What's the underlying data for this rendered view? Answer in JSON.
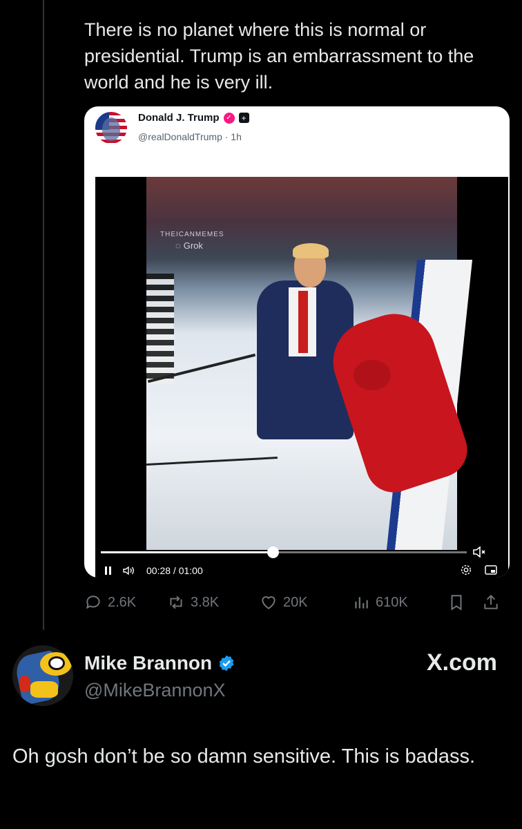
{
  "parent_tweet": {
    "text": "There is no planet where this is normal or presidential. Trump is an embarrassment to the world and he is very ill."
  },
  "quoted_tweet": {
    "author_name": "Donald J. Trump",
    "handle_time": "@realDonaldTrump · 1h",
    "video": {
      "watermark_top": "THEICANMEMES",
      "watermark_grok": "Grok",
      "time_display": "00:28 / 01:00",
      "progress_fraction": 0.47
    }
  },
  "actions": {
    "replies": "2.6K",
    "reposts": "3.8K",
    "likes": "20K",
    "views": "610K"
  },
  "reply_tweet": {
    "author_name": "Mike Brannon",
    "handle": "@MikeBrannonX",
    "brand": "X.com",
    "text": "Oh gosh don’t be so damn sensitive. This is badass."
  },
  "colors": {
    "background": "#000000",
    "text": "#e7e9ea",
    "muted": "#71767b",
    "verified_blue": "#1d9bf0",
    "affiliate_pink": "#f91880"
  }
}
